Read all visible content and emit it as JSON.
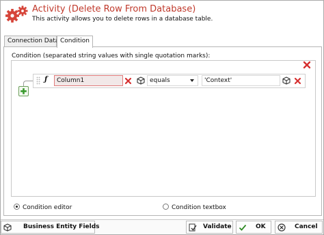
{
  "header": {
    "title": "Activity (Delete Row From Database)",
    "subtitle": "This activity allows you to delete rows in a database table.",
    "icon": "gears-icon"
  },
  "tabs": [
    {
      "label": "Connection Data",
      "active": false
    },
    {
      "label": "Condition",
      "active": true
    }
  ],
  "condition": {
    "label": "Condition (separated string values with single quotation marks):",
    "rows": [
      {
        "field": "Column1",
        "operator": "equals",
        "value": "'Context'"
      }
    ]
  },
  "mode": {
    "options": [
      {
        "label": "Condition editor",
        "selected": true
      },
      {
        "label": "Condition textbox",
        "selected": false
      }
    ]
  },
  "footer": {
    "business_entity_label": "Business Entity Fields",
    "validate_label": "Validate",
    "ok_label": "OK",
    "cancel_label": "Cancel"
  },
  "colors": {
    "accent_red": "#c0392b",
    "delete_red": "#d63030",
    "add_green": "#3a9b2e"
  }
}
